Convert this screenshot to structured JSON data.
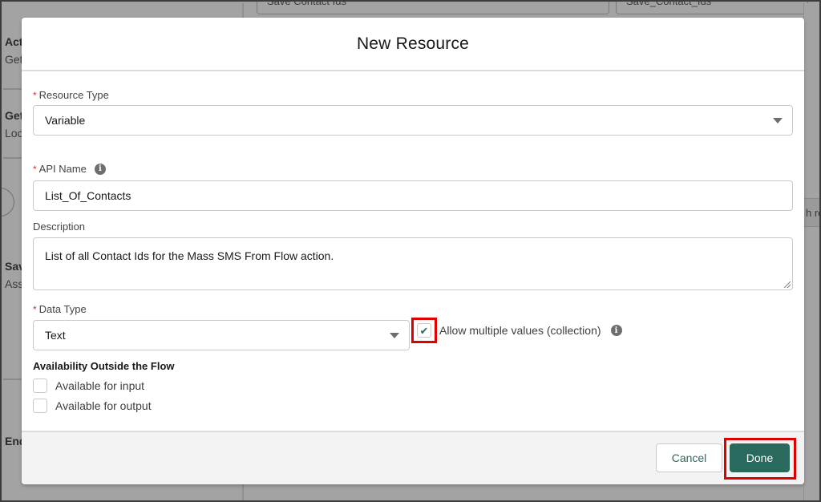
{
  "background": {
    "left_panel": [
      {
        "title": "Act",
        "subtitle": "Get"
      },
      {
        "title": "Get",
        "subtitle": "Loc"
      },
      {
        "title": "Sav",
        "subtitle": "Ass"
      },
      {
        "title": "End",
        "subtitle": ""
      }
    ],
    "top_inputs": [
      "Save Contact Ids",
      "Save_Contact_Ids"
    ],
    "right_text": "h re"
  },
  "modal": {
    "title": "New Resource",
    "resource_type": {
      "label": "Resource Type",
      "required_marker": "*",
      "value": "Variable",
      "icon": "chevron-down-icon"
    },
    "api_name": {
      "label": "API Name",
      "required_marker": "*",
      "info_icon": "i",
      "value": "List_Of_Contacts"
    },
    "description": {
      "label": "Description",
      "value": "List of all Contact Ids for the Mass SMS From Flow action."
    },
    "data_type": {
      "label": "Data Type",
      "required_marker": "*",
      "value": "Text"
    },
    "allow_multiple": {
      "label": "Allow multiple values (collection)",
      "checked": true,
      "check_glyph": "✔",
      "info_icon": "i"
    },
    "availability": {
      "heading": "Availability Outside the Flow",
      "options": [
        {
          "label": "Available for input",
          "checked": false
        },
        {
          "label": "Available for output",
          "checked": false
        }
      ]
    },
    "footer": {
      "cancel_label": "Cancel",
      "done_label": "Done"
    }
  },
  "colors": {
    "brand": "#2a6a5e",
    "required": "#c23934",
    "highlight": "#e00000",
    "overlay": "#a3a3a3"
  }
}
